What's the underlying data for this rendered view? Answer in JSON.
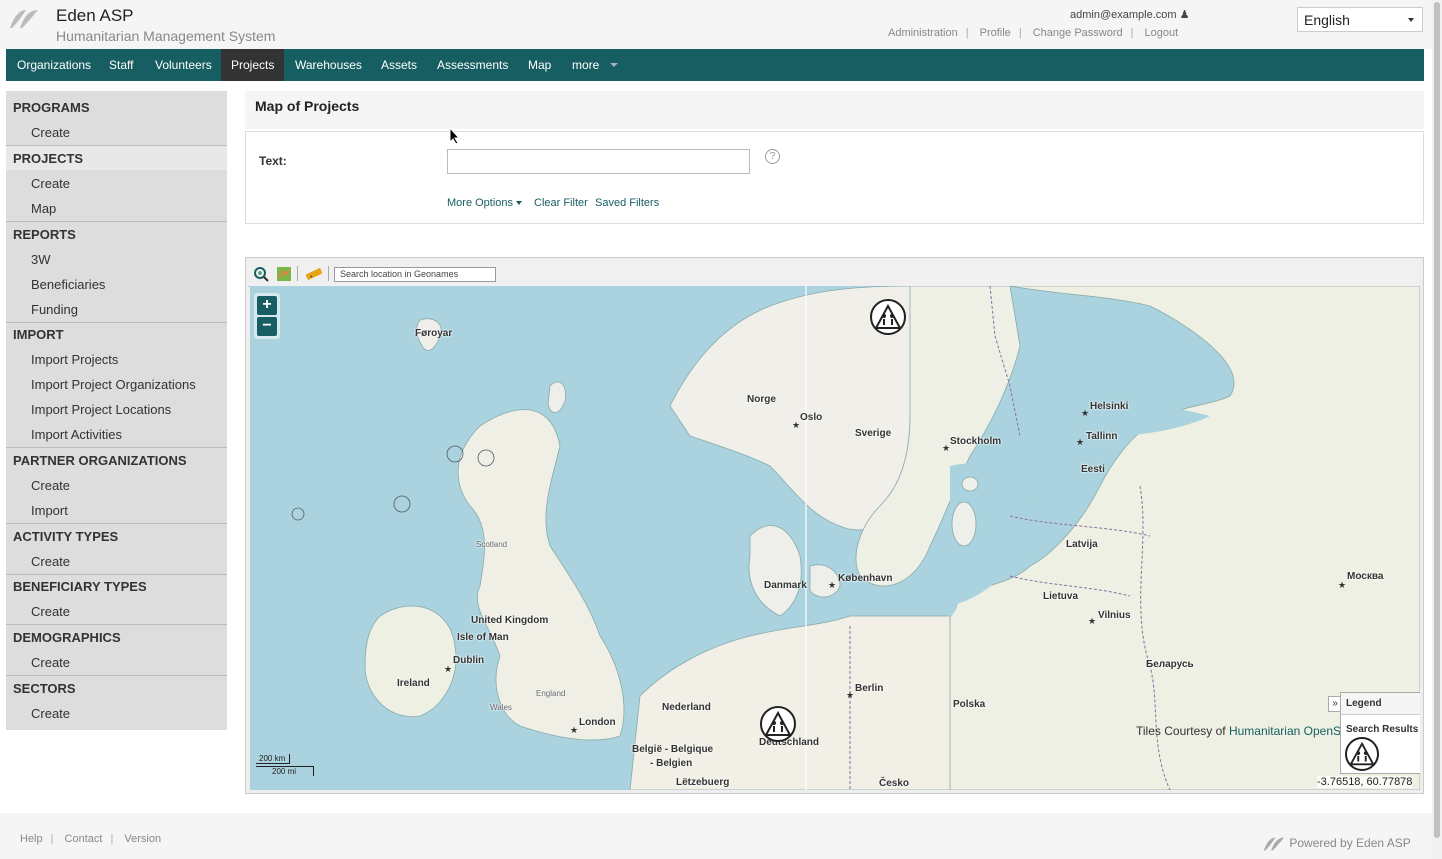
{
  "header": {
    "title": "Eden ASP",
    "subtitle": "Humanitarian Management System",
    "user_email": "admin@example.com",
    "links": [
      "Administration",
      "Profile",
      "Change Password",
      "Logout"
    ],
    "language": "English"
  },
  "nav": {
    "items": [
      "Organizations",
      "Staff",
      "Volunteers",
      "Projects",
      "Warehouses",
      "Assets",
      "Assessments",
      "Map",
      "more"
    ],
    "active": "Projects"
  },
  "sidebar": {
    "sections": [
      {
        "heading": "PROGRAMS",
        "items": [
          "Create"
        ]
      },
      {
        "heading": "PROJECTS",
        "items": [
          "Create",
          "Map"
        ]
      },
      {
        "heading": "REPORTS",
        "items": [
          "3W",
          "Beneficiaries",
          "Funding"
        ]
      },
      {
        "heading": "IMPORT",
        "items": [
          "Import Projects",
          "Import Project Organizations",
          "Import Project Locations",
          "Import Activities"
        ]
      },
      {
        "heading": "PARTNER ORGANIZATIONS",
        "items": [
          "Create",
          "Import"
        ]
      },
      {
        "heading": "ACTIVITY TYPES",
        "items": [
          "Create"
        ]
      },
      {
        "heading": "BENEFICIARY TYPES",
        "items": [
          "Create"
        ]
      },
      {
        "heading": "DEMOGRAPHICS",
        "items": [
          "Create"
        ]
      },
      {
        "heading": "SECTORS",
        "items": [
          "Create"
        ]
      }
    ]
  },
  "main": {
    "page_title": "Map of Projects",
    "filter": {
      "text_label": "Text:",
      "text_value": "",
      "help": "?",
      "more_options": "More Options",
      "clear_filter": "Clear Filter",
      "saved_filters": "Saved Filters"
    }
  },
  "map": {
    "search_placeholder": "Search location in Geonames",
    "zoom_in": "+",
    "zoom_out": "−",
    "labels": [
      "Føroyar",
      "Norge",
      "Oslo",
      "Sverige",
      "Stockholm",
      "Helsinki",
      "Tallinn",
      "Eesti",
      "Latvija",
      "Lietuva",
      "Vilnius",
      "Беларусь",
      "Москва",
      "Danmark",
      "København",
      "Scotland",
      "United Kingdom",
      "Isle of Man",
      "Dublin",
      "Ireland",
      "England",
      "Wales",
      "London",
      "Nederland",
      "België - Belgique",
      "- Belgien",
      "Lëtzebuerg",
      "Deutschland",
      "Berlin",
      "Polska",
      "Česko"
    ],
    "scale": [
      "200 km",
      "200 mi"
    ],
    "legend_title": "Legend",
    "legend_item": "Search Results",
    "attribution_prefix": "Tiles Courtesy of",
    "attribution_link": "Humanitarian OpenS",
    "coordinates": "-3.76518, 60.77878"
  },
  "footer": {
    "links": [
      "Help",
      "Contact",
      "Version"
    ],
    "powered": "Powered by Eden ASP"
  },
  "colors": {
    "brand": "#175e62",
    "nav_active": "#333333",
    "sea": "#aad3df"
  }
}
